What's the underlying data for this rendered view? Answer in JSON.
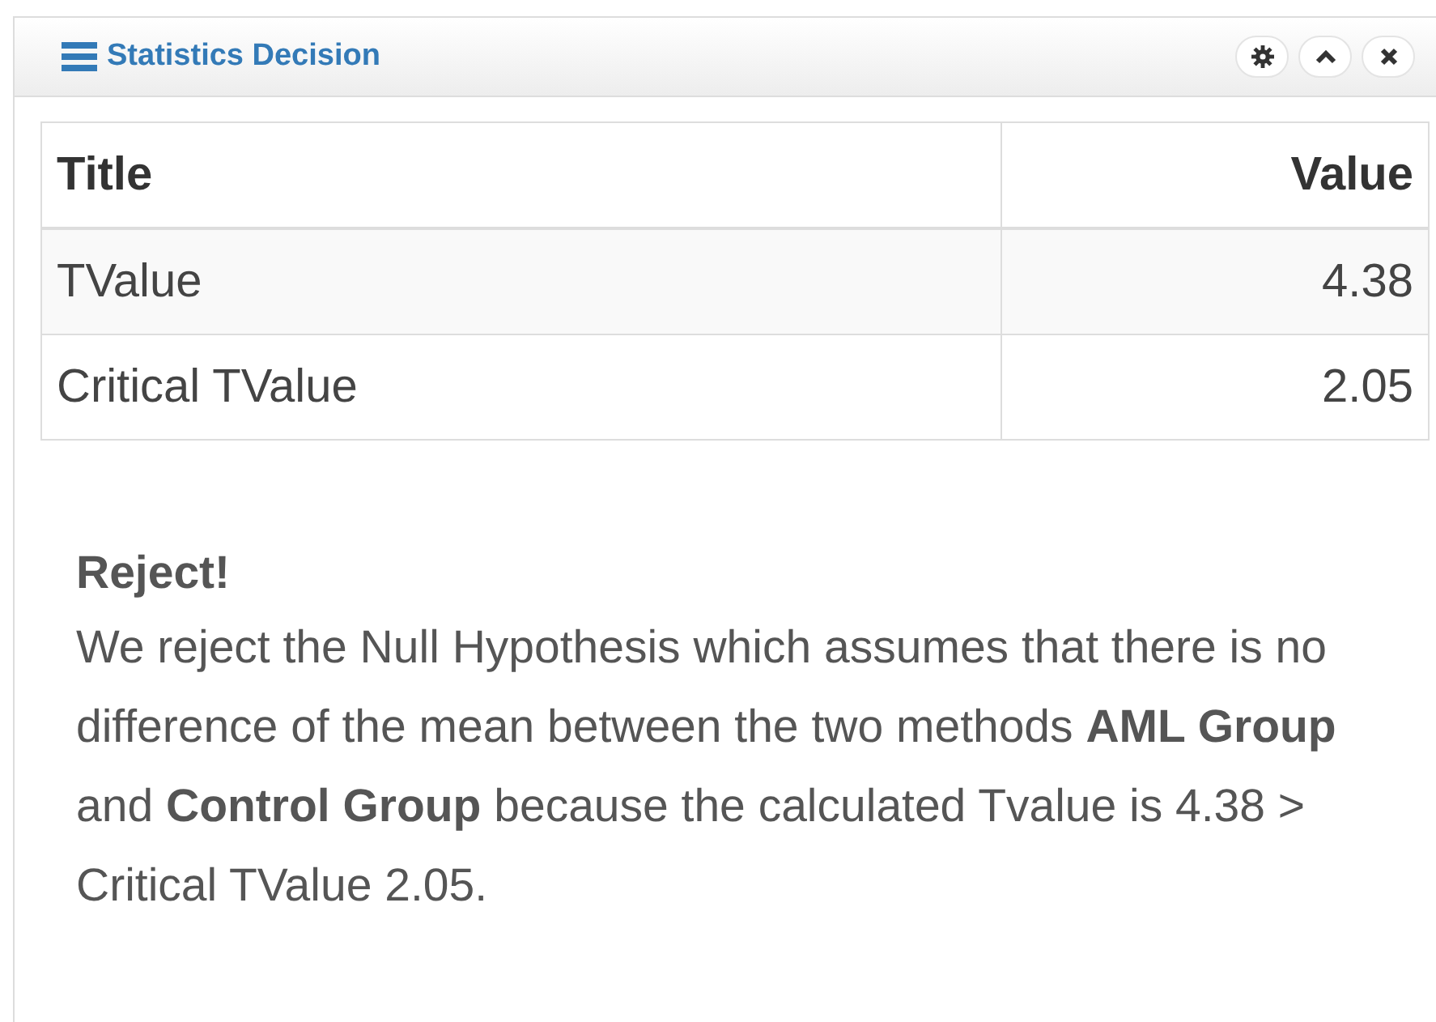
{
  "panel": {
    "title": "Statistics Decision"
  },
  "table": {
    "columns": [
      "Title",
      "Value"
    ],
    "rows": [
      {
        "title": "TValue",
        "value": "4.38"
      },
      {
        "title": "Critical TValue",
        "value": "2.05"
      }
    ]
  },
  "decision": {
    "heading": "Reject!",
    "text": "We reject the Null Hypothesis which assumes that there is no difference of the mean between the two methods **AML Group** and **Control Group** because the calculated Tvalue is 4.38 > Critical TValue 2.05."
  }
}
